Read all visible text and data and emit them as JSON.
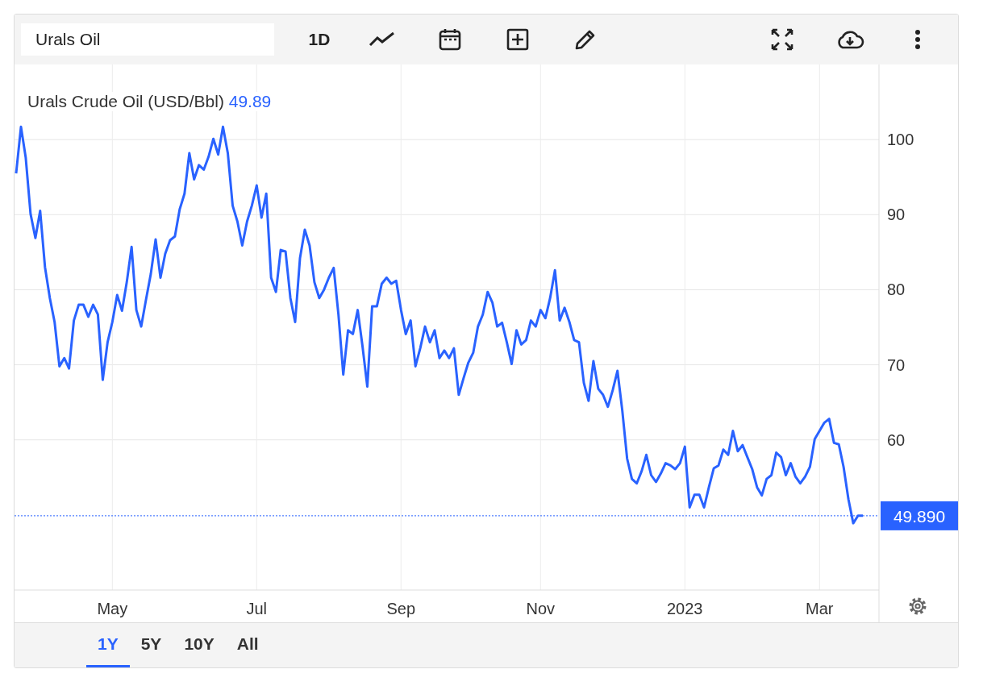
{
  "toolbar": {
    "search": {
      "value": "Urals Oil"
    },
    "interval": "1D"
  },
  "legend": {
    "value": "49.89"
  },
  "chart_data": {
    "type": "line",
    "grid": true,
    "ylim": [
      40,
      110
    ],
    "categories": [
      null,
      null,
      null,
      null,
      null,
      null,
      null,
      null,
      null,
      null,
      null,
      null,
      null,
      null,
      null,
      null,
      null,
      null,
      null,
      null,
      "May",
      null,
      null,
      null,
      null,
      null,
      null,
      null,
      null,
      null,
      null,
      null,
      null,
      null,
      null,
      null,
      null,
      null,
      null,
      null,
      null,
      null,
      null,
      null,
      null,
      null,
      null,
      null,
      null,
      null,
      "Jul",
      null,
      null,
      null,
      null,
      null,
      null,
      null,
      null,
      null,
      null,
      null,
      null,
      null,
      null,
      null,
      null,
      null,
      null,
      null,
      null,
      null,
      null,
      null,
      null,
      null,
      null,
      null,
      null,
      null,
      "Sep",
      null,
      null,
      null,
      null,
      null,
      null,
      null,
      null,
      null,
      null,
      null,
      null,
      null,
      null,
      null,
      null,
      null,
      null,
      null,
      null,
      null,
      null,
      null,
      null,
      null,
      null,
      null,
      null,
      "Nov",
      null,
      null,
      null,
      null,
      null,
      null,
      null,
      null,
      null,
      null,
      null,
      null,
      null,
      null,
      null,
      null,
      null,
      null,
      null,
      null,
      null,
      null,
      null,
      null,
      null,
      null,
      null,
      null,
      null,
      "2023",
      null,
      null,
      null,
      null,
      null,
      null,
      null,
      null,
      null,
      null,
      null,
      null,
      null,
      null,
      null,
      null,
      null,
      null,
      null,
      null,
      null,
      null,
      null,
      null,
      null,
      null,
      null,
      "Mar",
      null,
      null,
      null,
      null,
      null,
      null,
      null,
      null,
      null
    ],
    "yticks": [
      60,
      70,
      80,
      90,
      100
    ],
    "series": [
      {
        "name": "Urals Crude Oil (USD/Bbl)",
        "color": "#2962ff",
        "values": [
          95.5,
          101.7,
          97.6,
          90.1,
          86.9,
          90.5,
          83,
          78.9,
          75.7,
          69.8,
          70.9,
          69.5,
          75.9,
          78,
          78,
          76.4,
          78,
          76.7,
          68,
          73,
          75.7,
          79.3,
          77.2,
          81,
          85.7,
          77.3,
          75.1,
          78.7,
          82.1,
          86.7,
          81.6,
          84.8,
          86.6,
          87.1,
          90.7,
          92.8,
          98.2,
          94.7,
          96.6,
          96,
          97.7,
          100.1,
          98,
          101.7,
          98.2,
          91.2,
          89.1,
          85.9,
          89.1,
          91.2,
          93.9,
          89.6,
          92.8,
          81.6,
          79.7,
          85.3,
          85.1,
          78.9,
          75.7,
          84.2,
          88,
          85.9,
          81,
          78.9,
          80,
          81.6,
          82.9,
          76.7,
          68.7,
          74.6,
          74.1,
          77.3,
          72.5,
          67.1,
          77.8,
          77.8,
          80.8,
          81.6,
          80.8,
          81.2,
          77.3,
          74.1,
          75.9,
          69.8,
          72.2,
          75.1,
          73,
          74.6,
          70.9,
          71.9,
          70.9,
          72.2,
          66,
          68.2,
          70.3,
          71.6,
          75.1,
          76.7,
          79.7,
          78.3,
          75.1,
          75.6,
          73,
          70.1,
          74.6,
          72.7,
          73.3,
          75.9,
          75.1,
          77.3,
          76.2,
          78.9,
          82.6,
          75.9,
          77.6,
          75.7,
          73.3,
          73,
          67.6,
          65.2,
          70.5,
          66.8,
          66,
          64.4,
          66.6,
          69.2,
          63.9,
          57.5,
          54.8,
          54.2,
          55.8,
          58,
          55.3,
          54.4,
          55.5,
          56.9,
          56.6,
          56.1,
          56.9,
          59.1,
          51,
          52.7,
          52.7,
          51,
          53.7,
          56.2,
          56.6,
          58.7,
          58,
          61.2,
          58.5,
          59.3,
          57.7,
          56.1,
          53.7,
          52.6,
          54.8,
          55.3,
          58.3,
          57.7,
          55.3,
          56.9,
          55.1,
          54.2,
          55.1,
          56.4,
          60.1,
          61.2,
          62.3,
          62.8,
          59.6,
          59.4,
          56.4,
          52.1,
          48.9,
          49.9,
          49.9
        ]
      }
    ],
    "ref_lines": [
      {
        "axis": "y",
        "value": 49.89,
        "label": "49.890"
      }
    ]
  },
  "ranges": [
    {
      "label": "1Y",
      "selected": true
    },
    {
      "label": "5Y",
      "selected": false
    },
    {
      "label": "10Y",
      "selected": false
    },
    {
      "label": "All",
      "selected": false
    }
  ]
}
